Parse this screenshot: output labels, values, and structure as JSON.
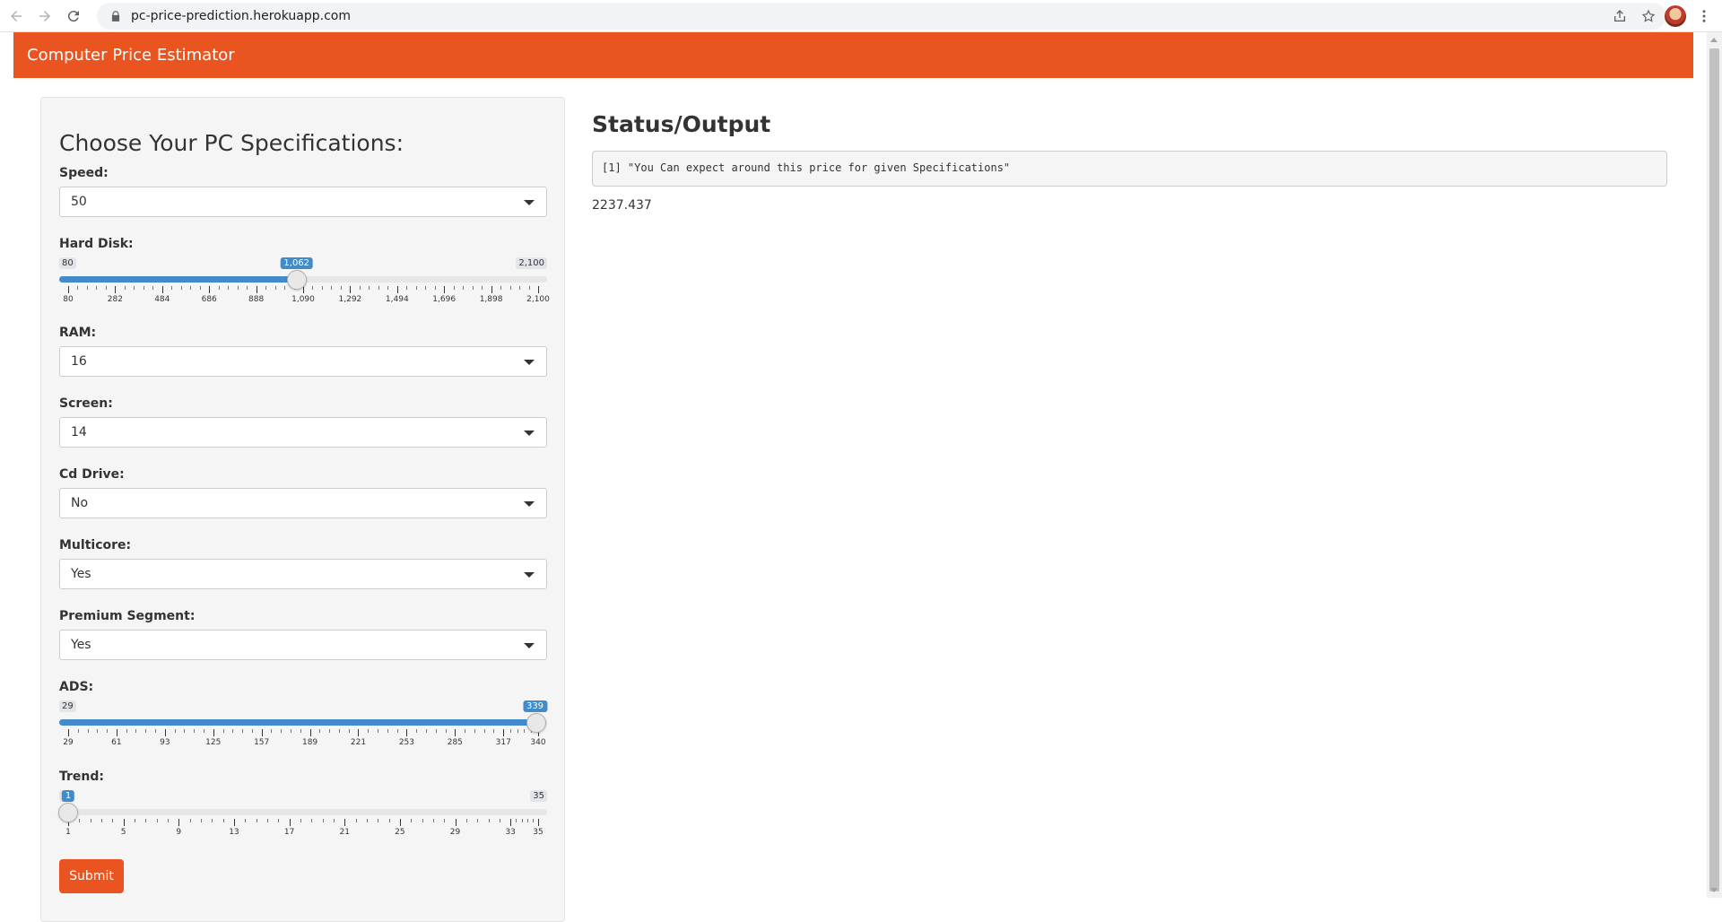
{
  "browser": {
    "url": "pc-price-prediction.herokuapp.com"
  },
  "app": {
    "brand": "Computer Price Estimator"
  },
  "sidebar": {
    "title": "Choose Your PC Specifications:",
    "speed": {
      "label": "Speed:",
      "value": "50"
    },
    "hard_disk": {
      "label": "Hard Disk:",
      "min": 80,
      "max": 2100,
      "value": 1062,
      "min_label": "80",
      "max_label": "2,100",
      "value_label": "1,062",
      "tick_labels": [
        "80",
        "282",
        "484",
        "686",
        "888",
        "1,090",
        "1,292",
        "1,494",
        "1,696",
        "1,898",
        "2,100"
      ]
    },
    "ram": {
      "label": "RAM:",
      "value": "16"
    },
    "screen": {
      "label": "Screen:",
      "value": "14"
    },
    "cd_drive": {
      "label": "Cd Drive:",
      "value": "No"
    },
    "multicore": {
      "label": "Multicore:",
      "value": "Yes"
    },
    "premium": {
      "label": "Premium Segment:",
      "value": "Yes"
    },
    "ads": {
      "label": "ADS:",
      "min": 29,
      "max": 340,
      "value": 339,
      "min_label": "29",
      "max_label": "340",
      "value_label": "339",
      "tick_labels": [
        "29",
        "61",
        "93",
        "125",
        "157",
        "189",
        "221",
        "253",
        "285",
        "317",
        "340"
      ],
      "tick_values": [
        29,
        61,
        93,
        125,
        157,
        189,
        221,
        253,
        285,
        317,
        340
      ]
    },
    "trend": {
      "label": "Trend:",
      "min": 1,
      "max": 35,
      "value": 1,
      "min_label": "1",
      "max_label": "35",
      "value_label": "1",
      "tick_labels": [
        "1",
        "5",
        "9",
        "13",
        "17",
        "21",
        "25",
        "29",
        "33",
        "35"
      ],
      "tick_values": [
        1,
        5,
        9,
        13,
        17,
        21,
        25,
        29,
        33,
        35
      ]
    },
    "submit_label": "Submit"
  },
  "main": {
    "title": "Status/Output",
    "output_text": "[1] \"You Can expect around this price for given Specifications\"",
    "predicted_price": "2237.437"
  },
  "colors": {
    "accent": "#E95420",
    "slider_fill": "#428bca"
  }
}
